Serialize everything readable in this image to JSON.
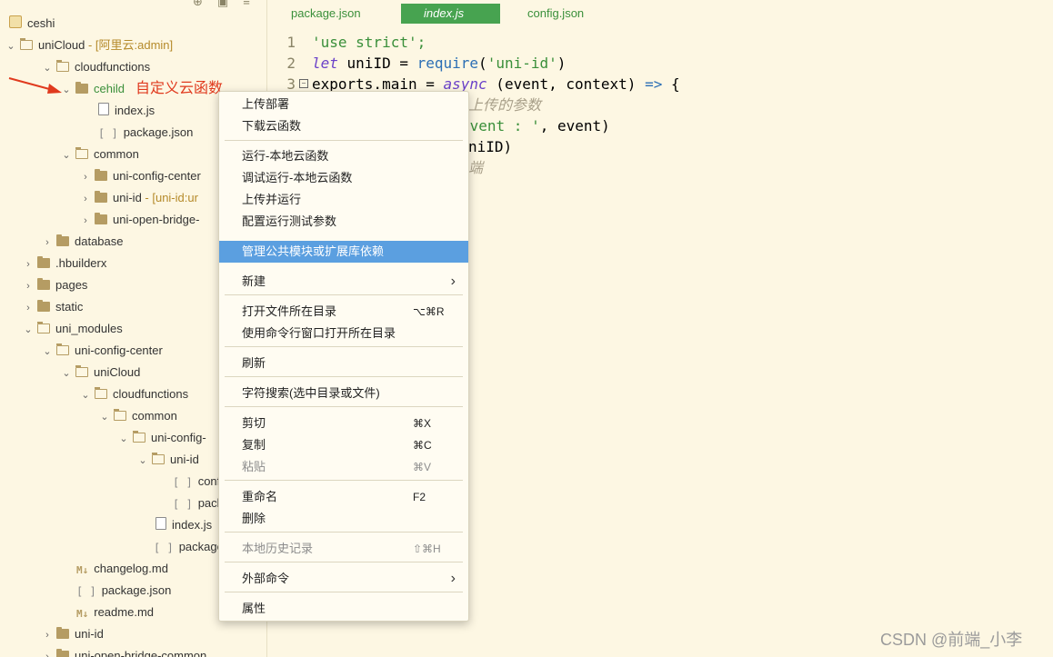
{
  "sidebar": {
    "tree": [
      {
        "label": "ceshi",
        "suffix": ""
      },
      {
        "label": "uniCloud",
        "suffix": " - [阿里云:admin]"
      },
      {
        "label": "cloudfunctions",
        "suffix": ""
      },
      {
        "label": "cehild",
        "suffix": ""
      },
      {
        "label": "index.js",
        "suffix": ""
      },
      {
        "label": "package.json",
        "suffix": ""
      },
      {
        "label": "common",
        "suffix": ""
      },
      {
        "label": "uni-config-center",
        "suffix": ""
      },
      {
        "label": "uni-id",
        "suffix": " - [uni-id:ur"
      },
      {
        "label": "uni-open-bridge-",
        "suffix": ""
      },
      {
        "label": "database",
        "suffix": ""
      },
      {
        "label": ".hbuilderx",
        "suffix": ""
      },
      {
        "label": "pages",
        "suffix": ""
      },
      {
        "label": "static",
        "suffix": ""
      },
      {
        "label": "uni_modules",
        "suffix": ""
      },
      {
        "label": "uni-config-center",
        "suffix": ""
      },
      {
        "label": "uniCloud",
        "suffix": ""
      },
      {
        "label": "cloudfunctions",
        "suffix": ""
      },
      {
        "label": "common",
        "suffix": ""
      },
      {
        "label": "uni-config-",
        "suffix": ""
      },
      {
        "label": "uni-id",
        "suffix": ""
      },
      {
        "label": "confi",
        "suffix": ""
      },
      {
        "label": "pack",
        "suffix": ""
      },
      {
        "label": "index.js",
        "suffix": ""
      },
      {
        "label": "package",
        "suffix": ""
      },
      {
        "label": "changelog.md",
        "suffix": ""
      },
      {
        "label": "package.json",
        "suffix": ""
      },
      {
        "label": "readme.md",
        "suffix": ""
      },
      {
        "label": "uni-id",
        "suffix": ""
      },
      {
        "label": "uni-open-bridge-common",
        "suffix": ""
      }
    ],
    "annotation": "自定义云函数"
  },
  "tabs": [
    "package.json",
    "index.js",
    "config.json"
  ],
  "code": {
    "line_numbers": [
      "1",
      "2",
      "3"
    ],
    "l1": "'use strict';",
    "l2_kw": "let",
    "l2_a": " uniID = ",
    "l2_fn": "require",
    "l2_b": "(",
    "l2_str": "'uni-id'",
    "l2_c": ")",
    "l3_a": "exports.main = ",
    "l3_kw": "async",
    "l3_b": " (event, context) ",
    "l3_arrow": "=>",
    "l3_c": " {",
    "l4_cm": "上传的参数",
    "l5_str": "event : '",
    "l5_b": ", event)",
    "l6": "niID)",
    "l7_cm": "端"
  },
  "context_menu": {
    "items": [
      {
        "label": "上传部署",
        "shortcut": ""
      },
      {
        "label": "下载云函数",
        "shortcut": ""
      },
      {
        "label": "运行-本地云函数",
        "shortcut": ""
      },
      {
        "label": "调试运行-本地云函数",
        "shortcut": ""
      },
      {
        "label": "上传并运行",
        "shortcut": ""
      },
      {
        "label": "配置运行测试参数",
        "shortcut": ""
      },
      {
        "label": "管理公共模块或扩展库依赖",
        "shortcut": ""
      },
      {
        "label": "新建",
        "shortcut": ""
      },
      {
        "label": "打开文件所在目录",
        "shortcut": "⌥⌘R"
      },
      {
        "label": "使用命令行窗口打开所在目录",
        "shortcut": ""
      },
      {
        "label": "刷新",
        "shortcut": ""
      },
      {
        "label": "字符搜索(选中目录或文件)",
        "shortcut": ""
      },
      {
        "label": "剪切",
        "shortcut": "⌘X"
      },
      {
        "label": "复制",
        "shortcut": "⌘C"
      },
      {
        "label": "粘贴",
        "shortcut": "⌘V"
      },
      {
        "label": "重命名",
        "shortcut": "F2"
      },
      {
        "label": "删除",
        "shortcut": ""
      },
      {
        "label": "本地历史记录",
        "shortcut": "⇧⌘H"
      },
      {
        "label": "外部命令",
        "shortcut": ""
      },
      {
        "label": "属性",
        "shortcut": ""
      }
    ]
  },
  "watermark": "CSDN @前端_小李",
  "colors": {
    "background": "#fdf7e3",
    "highlight": "#5b9fe0",
    "active_tab": "#47a350",
    "annotation": "#e03a1e"
  }
}
